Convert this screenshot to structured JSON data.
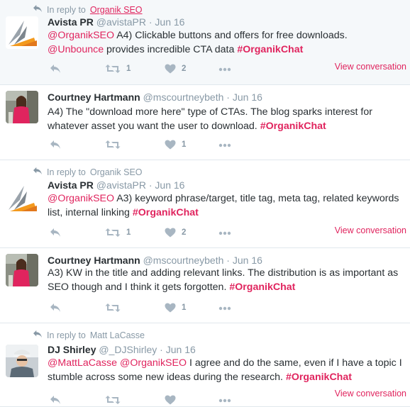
{
  "tweets": [
    {
      "context": {
        "prefix": "In reply to",
        "target": "Organik SEO",
        "target_link": true
      },
      "name": "Avista PR",
      "handle": "@avistaPR",
      "dot": "·",
      "time": "Jun 16",
      "avatar": "avista-logo",
      "text": [
        {
          "t": "@OrganikSEO",
          "k": "mention"
        },
        {
          "t": " A4) Clickable buttons and offers for free downloads. ",
          "k": "plain"
        },
        {
          "t": "@Unbounce",
          "k": "mention"
        },
        {
          "t": " provides incredible CTA data ",
          "k": "plain"
        },
        {
          "t": "#OrganikChat",
          "k": "hashtag"
        }
      ],
      "retweets": "1",
      "likes": "2",
      "view_conversation": "View conversation"
    },
    {
      "context": null,
      "name": "Courtney Hartmann",
      "handle": "@mscourtneybeth",
      "dot": "·",
      "time": "Jun 16",
      "avatar": "courtney-photo",
      "text": [
        {
          "t": "A4) The \"download more here\" type of CTAs. The blog sparks interest for whatever asset you want the user to download. ",
          "k": "plain"
        },
        {
          "t": "#OrganikChat",
          "k": "hashtag"
        }
      ],
      "retweets": "",
      "likes": "1",
      "view_conversation": ""
    },
    {
      "context": {
        "prefix": "In reply to",
        "target": "Organik SEO",
        "target_link": false
      },
      "name": "Avista PR",
      "handle": "@avistaPR",
      "dot": "·",
      "time": "Jun 16",
      "avatar": "avista-logo",
      "text": [
        {
          "t": "@OrganikSEO",
          "k": "mention"
        },
        {
          "t": " A3) keyword phrase/target, title tag, meta tag, related keywords list, internal linking ",
          "k": "plain"
        },
        {
          "t": "#OrganikChat",
          "k": "hashtag"
        }
      ],
      "retweets": "1",
      "likes": "2",
      "view_conversation": "View conversation"
    },
    {
      "context": null,
      "name": "Courtney Hartmann",
      "handle": "@mscourtneybeth",
      "dot": "·",
      "time": "Jun 16",
      "avatar": "courtney-photo",
      "text": [
        {
          "t": "A3) KW in the title and adding relevant links. The distribution is as important as SEO though and I think it gets forgotten. ",
          "k": "plain"
        },
        {
          "t": "#OrganikChat",
          "k": "hashtag"
        }
      ],
      "retweets": "",
      "likes": "1",
      "view_conversation": ""
    },
    {
      "context": {
        "prefix": "In reply to",
        "target": "Matt LaCasse",
        "target_link": false
      },
      "name": "DJ Shirley",
      "handle": "@_DJShirley",
      "dot": "·",
      "time": "Jun 16",
      "avatar": "dj-photo",
      "text": [
        {
          "t": "@MattLaCasse",
          "k": "mention"
        },
        {
          "t": " ",
          "k": "plain"
        },
        {
          "t": "@OrganikSEO",
          "k": "mention"
        },
        {
          "t": " I agree and do the same, even if I have a topic I stumble across some new ideas during the research. ",
          "k": "plain"
        },
        {
          "t": "#OrganikChat",
          "k": "hashtag"
        }
      ],
      "retweets": "",
      "likes": "",
      "view_conversation": "View conversation"
    }
  ],
  "colors": {
    "accent": "#e0245e",
    "muted": "#8899a6",
    "text": "#292f33",
    "border": "#e1e8ed",
    "highlight_bg": "#f5f8fa"
  }
}
